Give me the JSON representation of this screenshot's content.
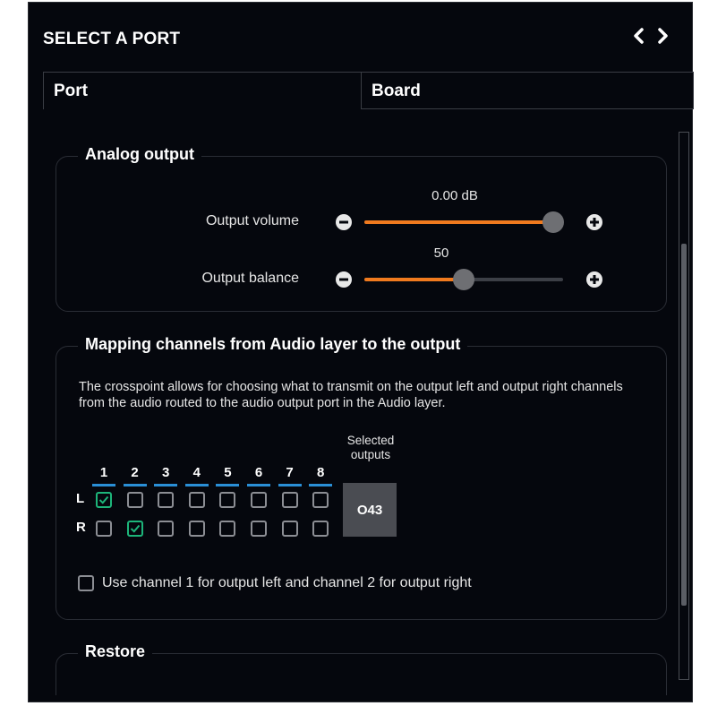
{
  "panel": {
    "title": "SELECT A PORT",
    "tabs": [
      {
        "label": "Port"
      },
      {
        "label": "Board"
      }
    ]
  },
  "analog_output": {
    "title": "Analog output",
    "volume": {
      "label": "Output volume",
      "value_text": "0.00 dB",
      "level": 0.95
    },
    "balance": {
      "label": "Output balance",
      "value_text": "50",
      "level": 0.5
    }
  },
  "mapping": {
    "title": "Mapping channels from Audio layer to the output",
    "description": "The crosspoint allows for choosing what to transmit on the output left and output right channels from the audio routed to the audio output port in the Audio layer.",
    "columns": [
      "1",
      "2",
      "3",
      "4",
      "5",
      "6",
      "7",
      "8"
    ],
    "rows": [
      {
        "label": "L",
        "checked": [
          true,
          false,
          false,
          false,
          false,
          false,
          false,
          false
        ]
      },
      {
        "label": "R",
        "checked": [
          false,
          true,
          false,
          false,
          false,
          false,
          false,
          false
        ]
      }
    ],
    "selected_outputs_label": "Selected outputs",
    "selected_outputs_value": "O43",
    "option_label": "Use channel 1 for output left and channel 2 for output right",
    "option_checked": false
  },
  "restore": {
    "title": "Restore"
  },
  "colors": {
    "accent": "#f07a1e",
    "check": "#1db57a",
    "column_underline": "#2a8fd6"
  },
  "icons": {
    "prev": "chevron-left-icon",
    "next": "chevron-right-icon",
    "minus": "minus-circle-icon",
    "plus": "plus-circle-icon",
    "check": "checkmark-icon"
  }
}
